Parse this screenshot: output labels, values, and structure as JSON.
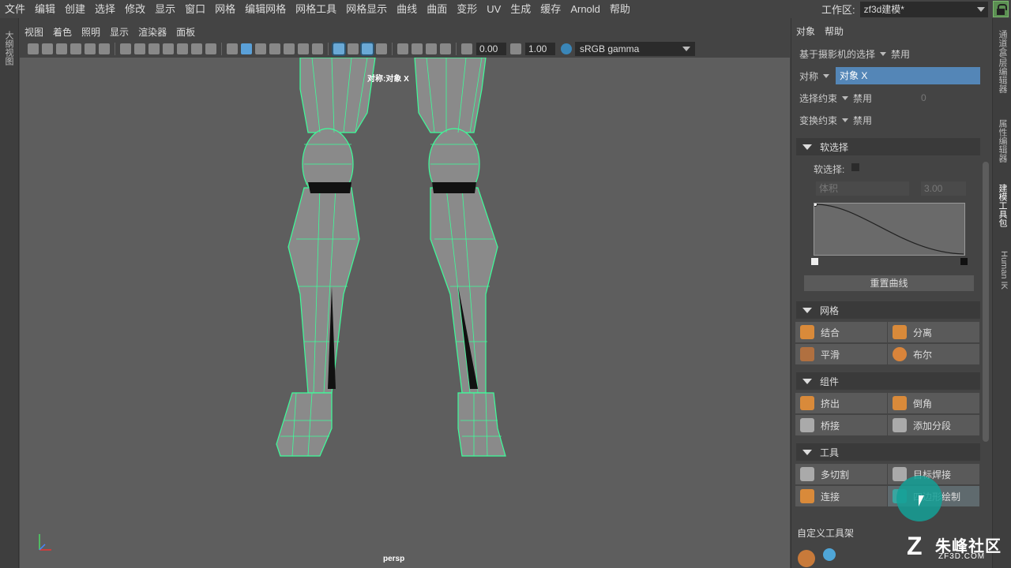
{
  "menubar": {
    "items": [
      "文件",
      "编辑",
      "创建",
      "选择",
      "修改",
      "显示",
      "窗口",
      "网格",
      "编辑网格",
      "网格工具",
      "网格显示",
      "曲线",
      "曲面",
      "变形",
      "UV",
      "生成",
      "缓存",
      "Arnold",
      "帮助"
    ]
  },
  "workspace": {
    "label": "工作区:",
    "value": "zf3d建模*"
  },
  "left_strip": {
    "tab": "大纲视图"
  },
  "viewport": {
    "menu": [
      "视图",
      "着色",
      "照明",
      "显示",
      "渲染器",
      "面板"
    ],
    "field1": "0.00",
    "field2": "1.00",
    "color_space": "sRGB gamma",
    "symmetry_label": "对称:对象 X",
    "camera": "persp"
  },
  "right_strip": {
    "tabs": [
      "通道盒/层编辑器",
      "属性编辑器",
      "建模工具包",
      "Human IK"
    ]
  },
  "modeling_toolkit": {
    "menu": [
      "对象",
      "帮助"
    ],
    "camera_select": {
      "label": "基于摄影机的选择",
      "value": "禁用"
    },
    "symmetry": {
      "label": "对称",
      "value": "对象 X"
    },
    "select_constraint": {
      "label": "选择约束",
      "value": "禁用",
      "num": "0"
    },
    "transform_constraint": {
      "label": "变换约束",
      "value": "禁用"
    },
    "soft_select": {
      "title": "软选择",
      "checkbox_label": "软选择:",
      "falloff_mode": "体积",
      "falloff_value": "3.00",
      "reset_label": "重置曲线"
    },
    "mesh": {
      "title": "网格",
      "tools": [
        "结合",
        "分离",
        "平滑",
        "布尔"
      ]
    },
    "components": {
      "title": "组件",
      "tools": [
        "挤出",
        "倒角",
        "桥接",
        "添加分段"
      ]
    },
    "tools": {
      "title": "工具",
      "items": [
        "多切割",
        "目标焊接",
        "连接",
        "四边形绘制"
      ]
    },
    "custom_shelf": "自定义工具架"
  },
  "watermark": {
    "name": "朱峰社区",
    "url": "ZF3D.COM"
  }
}
